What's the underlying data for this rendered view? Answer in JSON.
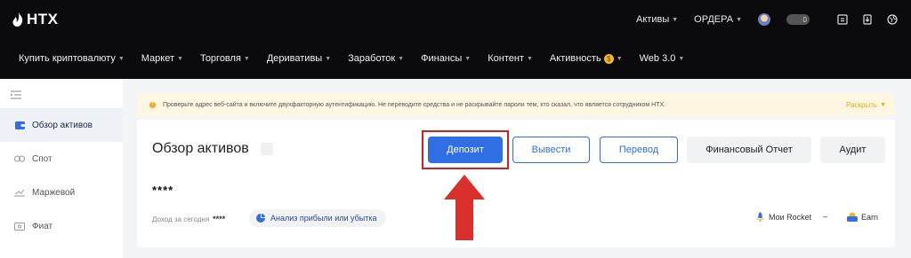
{
  "brand": {
    "name": "HTX"
  },
  "top_right": {
    "assets": "Активы",
    "orders": "ОРДЕРА",
    "toggle_text": "0"
  },
  "nav": [
    {
      "label": "Купить криптовалюту",
      "has_caret": true
    },
    {
      "label": "Маркет",
      "has_caret": true
    },
    {
      "label": "Торговля",
      "has_caret": true
    },
    {
      "label": "Деривативы",
      "has_caret": true
    },
    {
      "label": "Заработок",
      "has_caret": true
    },
    {
      "label": "Финансы",
      "has_caret": true
    },
    {
      "label": "Контент",
      "has_caret": true
    },
    {
      "label": "Активность",
      "has_caret": true,
      "badge": "coin-icon"
    },
    {
      "label": "Web 3.0",
      "has_caret": true
    }
  ],
  "sidebar": {
    "items": [
      {
        "label": "Обзор активов",
        "active": true,
        "icon": "wallet-icon"
      },
      {
        "label": "Спот",
        "active": false,
        "icon": "spot-icon"
      },
      {
        "label": "Маржевой",
        "active": false,
        "icon": "margin-icon"
      },
      {
        "label": "Фиат",
        "active": false,
        "icon": "fiat-icon"
      }
    ]
  },
  "alert": {
    "text": "Проверьте адрес веб-сайта и включите двухфакторную аутентификацию. Не переводите средства и не раскрывайте пароли тем, кто сказал, что является сотрудником HTX.",
    "expand_label": "Раскрыть"
  },
  "overview": {
    "title": "Обзор активов",
    "balance_masked": "****",
    "income_label": "Доход за сегодня",
    "income_value": "****",
    "pnl_label": "Анализ прибыли или убытка",
    "rocket_label": "Мои Rocket",
    "rocket_value": "–",
    "earn_label": "Earn"
  },
  "actions": {
    "deposit": "Депозит",
    "withdraw": "Вывести",
    "transfer": "Перевод",
    "report": "Финансовый Отчет",
    "audit": "Аудит"
  },
  "colors": {
    "topbar": "#0b0b0d",
    "primary": "#2f6ee3",
    "highlight": "#d11f1f",
    "alert_bg": "#fef6e0",
    "alert_accent": "#e0a81a"
  }
}
